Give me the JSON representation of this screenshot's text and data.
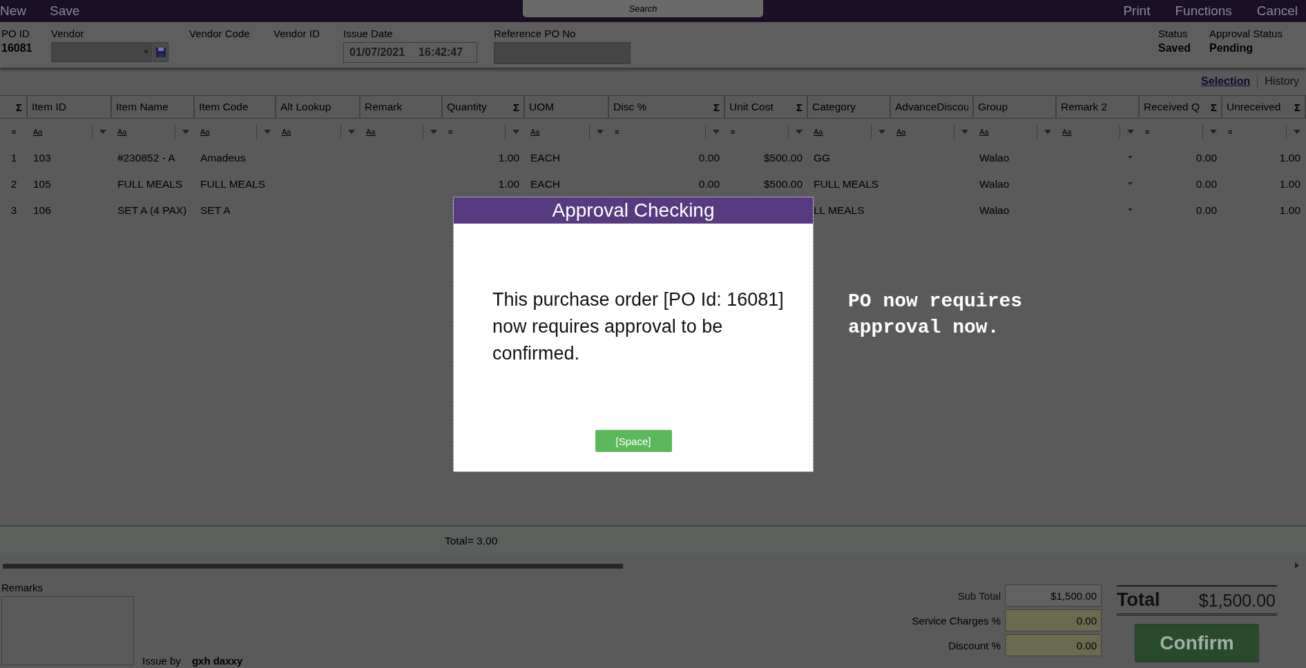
{
  "toolbar": {
    "left": [
      "New",
      "Save"
    ],
    "search": {
      "placeholder": "Search"
    },
    "right": [
      "Print",
      "Functions",
      "Cancel"
    ]
  },
  "header": {
    "po_id": {
      "label": "PO ID",
      "value": "16081"
    },
    "vendor": {
      "label": "Vendor"
    },
    "vendor_code": {
      "label": "Vendor Code"
    },
    "vendor_id": {
      "label": "Vendor ID"
    },
    "issue_date": {
      "label": "Issue Date",
      "date": "01/07/2021",
      "time": "16:42:47"
    },
    "reference_po": {
      "label": "Reference PO No"
    },
    "status": {
      "label": "Status",
      "value": "Saved"
    },
    "approval_status": {
      "label": "Approval Status",
      "value": "Pending"
    }
  },
  "view_tabs": [
    {
      "label": "Selection",
      "selected": true
    },
    {
      "label": "History",
      "selected": false
    }
  ],
  "table": {
    "columns": [
      {
        "kind": "number",
        "sigma": "Σ",
        "filter": "="
      },
      {
        "label": "Item ID",
        "kind": "text",
        "filter": "Aa"
      },
      {
        "label": "Item Name",
        "kind": "text",
        "filter": "Aa"
      },
      {
        "label": "Item Code",
        "kind": "text",
        "filter": "Aa"
      },
      {
        "label": "Alt Lookup",
        "kind": "text",
        "filter": "Aa"
      },
      {
        "label": "Remark",
        "kind": "text",
        "filter": "Aa"
      },
      {
        "label": "Quantity",
        "kind": "number",
        "sigma": "Σ",
        "filter": "="
      },
      {
        "label": "UOM",
        "kind": "text",
        "filter": "Aa"
      },
      {
        "label": "Disc %",
        "kind": "number",
        "sigma": "Σ",
        "filter": "="
      },
      {
        "label": "Unit Cost",
        "kind": "number",
        "sigma": "Σ",
        "filter": "="
      },
      {
        "label": "Category",
        "kind": "text",
        "filter": "Aa"
      },
      {
        "label": "AdvanceDiscou",
        "kind": "text",
        "filter": "Aa"
      },
      {
        "label": "Group",
        "kind": "text",
        "filter": "Aa"
      },
      {
        "label": "Remark 2",
        "kind": "dropdown",
        "filter": "Aa"
      },
      {
        "label": "Received Q",
        "kind": "number",
        "sigma": "Σ",
        "filter": "="
      },
      {
        "label": "Unreceived",
        "kind": "number",
        "sigma": "Σ",
        "filter": "="
      }
    ],
    "rows": [
      [
        "1",
        "103",
        "#230852 - A",
        "Amadeus",
        "",
        "",
        "1.00",
        "EACH",
        "0.00",
        "$500.00",
        "GG",
        "",
        "Walao",
        "",
        "0.00",
        "1.00"
      ],
      [
        "2",
        "105",
        "FULL MEALS",
        "FULL MEALS",
        "",
        "",
        "1.00",
        "EACH",
        "0.00",
        "$500.00",
        "FULL MEALS",
        "",
        "Walao",
        "",
        "0.00",
        "1.00"
      ],
      [
        "3",
        "106",
        "SET A (4 PAX)",
        "SET A",
        "",
        "",
        "",
        "",
        "",
        "",
        "LL MEALS",
        "",
        "Walao",
        "",
        "0.00",
        "1.00"
      ]
    ],
    "footer_total": "Total= 3.00"
  },
  "bottom": {
    "remarks_label": "Remarks",
    "issue_by_label": "Issue by",
    "issue_by": "gxh daxxy",
    "sub_total": {
      "label": "Sub Total",
      "value": "$1,500.00"
    },
    "service_charges": {
      "label": "Service Charges %",
      "value": "0.00"
    },
    "discount": {
      "label": "Discount %",
      "value": "0.00"
    },
    "total_label": "Total",
    "total_value": "$1,500.00",
    "confirm": "Confirm"
  },
  "dialog": {
    "title": "Approval Checking",
    "message": "This purchase order [PO Id: 16081] now requires approval to be confirmed.",
    "button": "[Space]"
  },
  "annotation": "PO now requires approval now."
}
